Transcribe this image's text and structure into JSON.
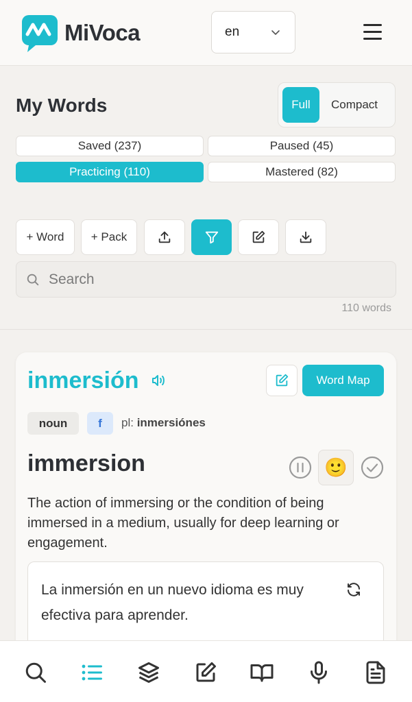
{
  "header": {
    "brand": "MiVoca",
    "language": "en",
    "brand_color": "#1dbccd"
  },
  "words_section": {
    "title": "My Words",
    "view_toggle": {
      "full": "Full",
      "compact": "Compact",
      "selected": "Full"
    },
    "tabs": [
      {
        "label": "Saved (237)",
        "active": false
      },
      {
        "label": "Paused (45)",
        "active": false
      },
      {
        "label": "Practicing (110)",
        "active": true
      },
      {
        "label": "Mastered (82)",
        "active": false
      }
    ],
    "toolbar": {
      "add_word": "+ Word",
      "add_pack": "+ Pack",
      "icons": [
        "upload-icon",
        "filter-icon",
        "edit-icon",
        "download-icon"
      ]
    },
    "search": {
      "placeholder": "Search"
    },
    "word_count": "110 words"
  },
  "card": {
    "word": "inmersión",
    "word_map_label": "Word Map",
    "part_of_speech": "noun",
    "gender": "f",
    "plural_prefix": "pl:",
    "plural": "inmersiónes",
    "translation": "immersion",
    "emoji": "🙂",
    "definition": "The action of immersing or the condition of being immersed in a medium, usually for deep learning or engagement.",
    "example": "La inmersión en un nuevo idioma es muy efectiva para aprender."
  },
  "bottom_nav": {
    "items": [
      "search-icon",
      "list-icon",
      "layers-icon",
      "edit-icon",
      "book-icon",
      "microphone-icon",
      "document-icon"
    ],
    "active": "list-icon"
  }
}
